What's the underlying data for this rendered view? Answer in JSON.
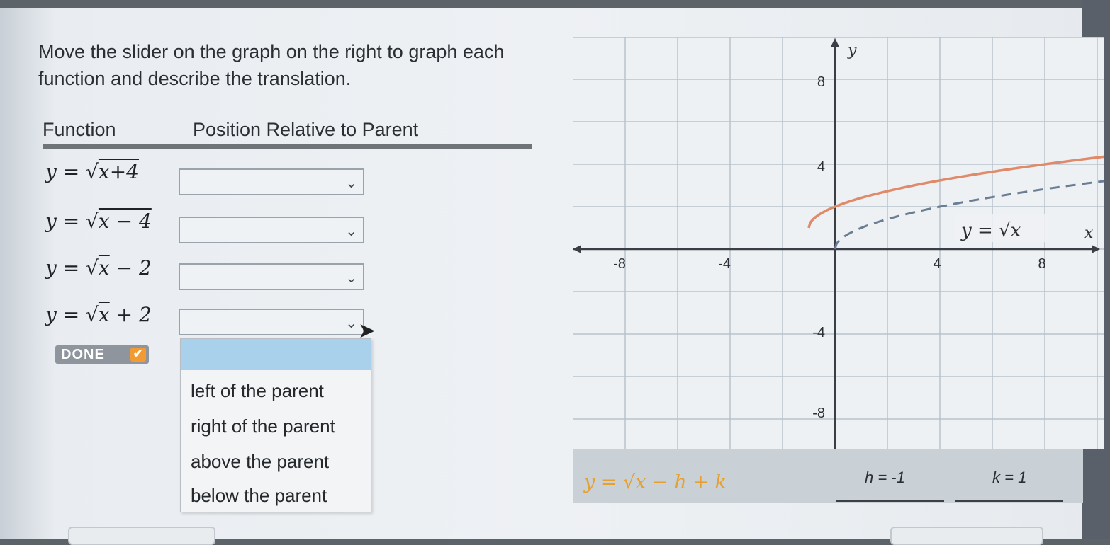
{
  "instructions": "Move the slider on the graph on the right to graph each function and describe the translation.",
  "table": {
    "col_function": "Function",
    "col_position": "Position Relative to Parent",
    "rows": [
      {
        "base": "y = √",
        "radicand": "x+4",
        "tail": "",
        "selected": ""
      },
      {
        "base": "y = √",
        "radicand": "x − 4",
        "tail": "",
        "selected": ""
      },
      {
        "base": "y = √",
        "radicand": "x",
        "tail": " − 2",
        "selected": ""
      },
      {
        "base": "y = √",
        "radicand": "x",
        "tail": " + 2",
        "selected": ""
      }
    ]
  },
  "done_label": "DONE",
  "dropdown_options": [
    "left of the parent",
    "right of the parent",
    "above the parent",
    "below the parent"
  ],
  "graph": {
    "y_axis_label": "y",
    "x_axis_label": "x",
    "x_ticks": [
      "-8",
      "-4",
      "4",
      "8"
    ],
    "y_ticks": [
      "8",
      "4",
      "-4",
      "-8"
    ],
    "parent_label": "y = √x",
    "h_value": -1,
    "k_value": 1,
    "curve_color": "#e08a6a",
    "parent_color": "#6b7d92"
  },
  "sliders": {
    "equation": "y = √x − h + k",
    "h_label": "h = -1",
    "k_label": "k = 1"
  }
}
